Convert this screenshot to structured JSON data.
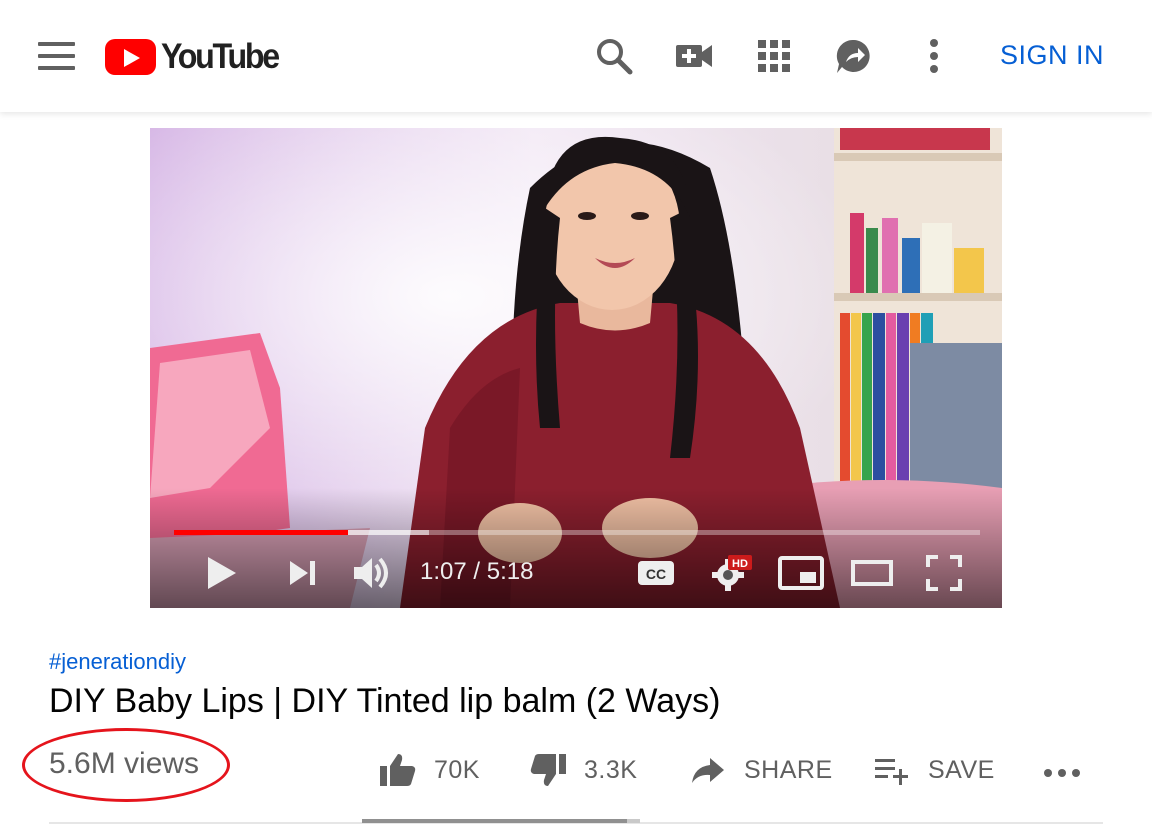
{
  "header": {
    "logo_text": "YouTube",
    "icons": [
      "menu-icon",
      "search-icon",
      "create-video-icon",
      "apps-grid-icon",
      "messages-icon",
      "more-vert-icon"
    ],
    "sign_in_label": "SIGN IN",
    "colors": {
      "brand_red": "#ff0000",
      "link_blue": "#065fd4"
    }
  },
  "player": {
    "current_time": "1:07",
    "duration": "5:18",
    "time_display": "1:07 / 5:18",
    "played_fraction": 0.2154,
    "hd_badge": "HD",
    "cc_label": "CC",
    "controls": [
      "play-icon",
      "next-icon",
      "volume-icon",
      "captions-icon",
      "settings-icon",
      "miniplayer-icon",
      "theater-icon",
      "fullscreen-icon"
    ]
  },
  "video": {
    "hashtag": "#jenerationdiy",
    "title": "DIY Baby Lips | DIY Tinted lip balm (2 Ways)",
    "views": "5.6M views",
    "like_count": "70K",
    "dislike_count": "3.3K",
    "share_label": "SHARE",
    "save_label": "SAVE",
    "like_ratio": 0.955
  }
}
